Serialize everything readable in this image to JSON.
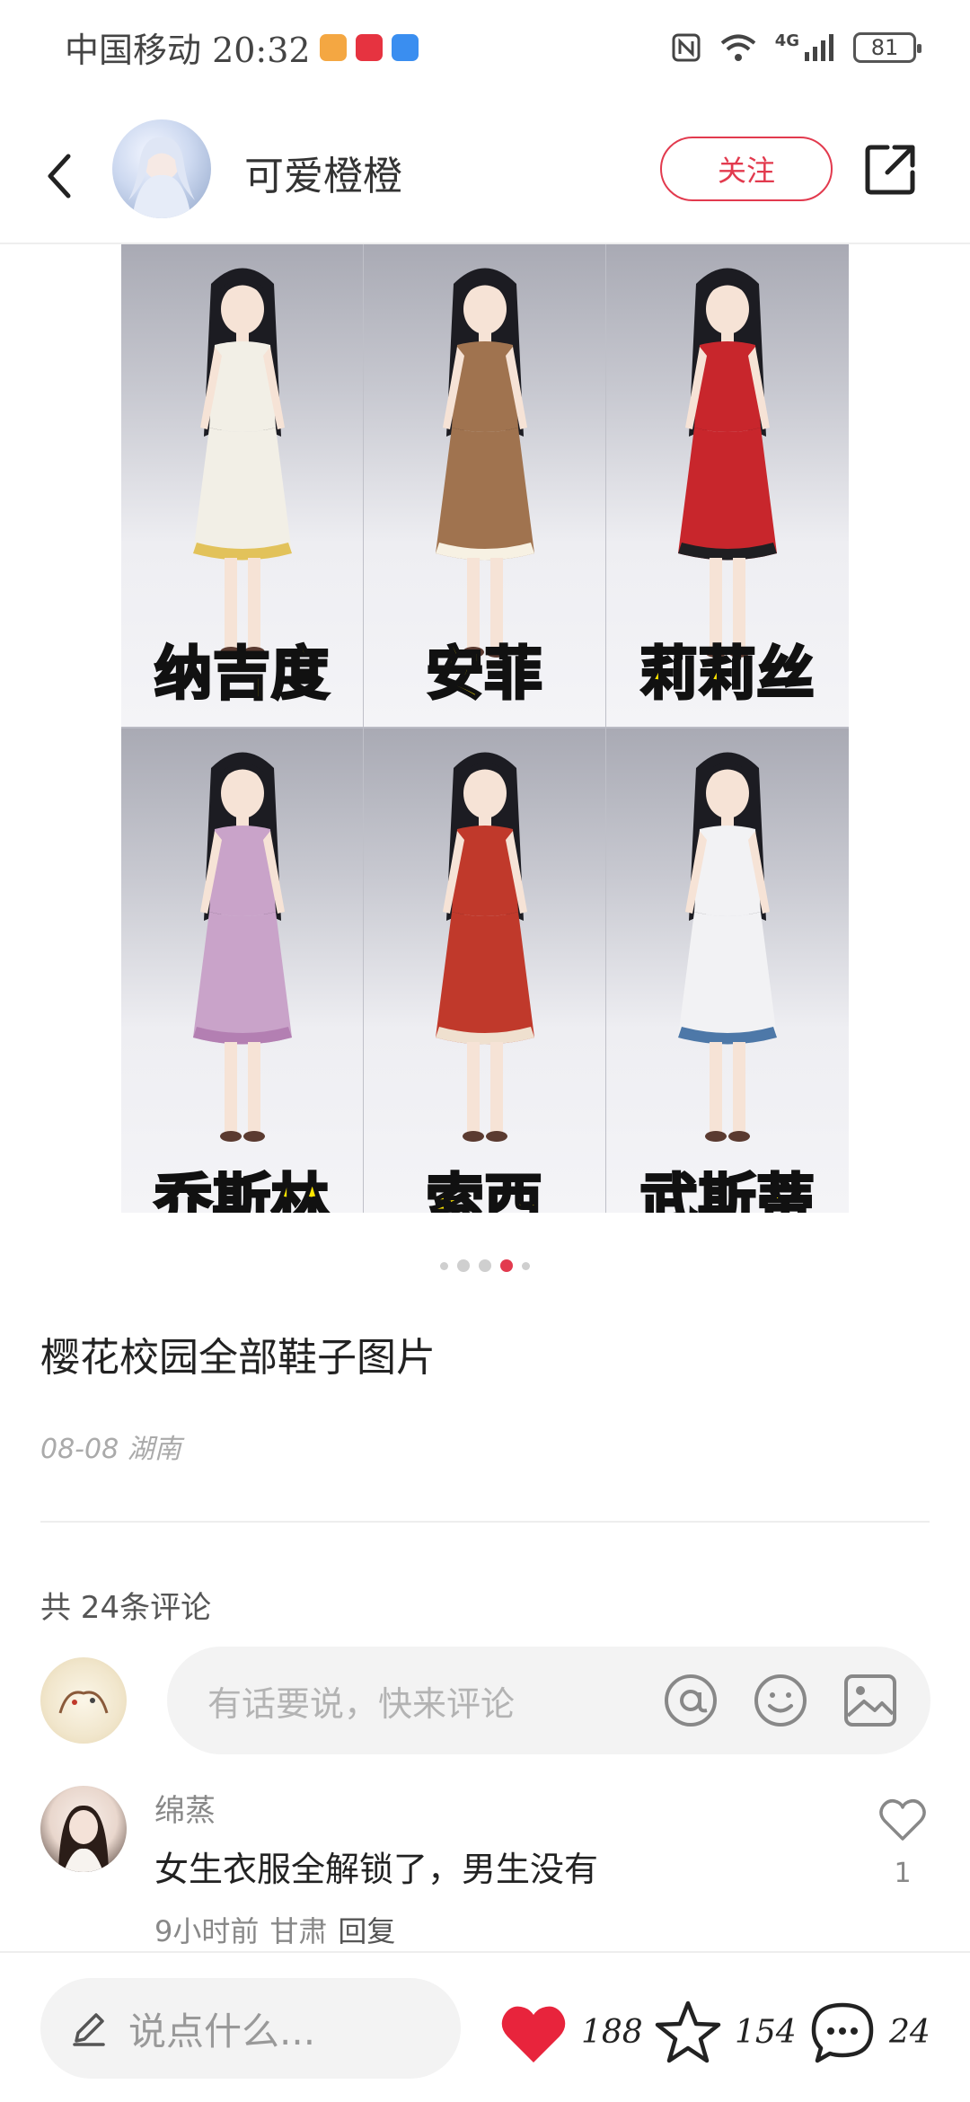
{
  "status_bar": {
    "carrier_time": "中国移动 20:32",
    "network": "4G",
    "battery": "81",
    "app_icon_colors": [
      "#f4a742",
      "#e63340",
      "#3a8ef0"
    ],
    "icons": [
      "nfc-icon",
      "wifi-icon",
      "signal-icon",
      "battery-icon"
    ]
  },
  "header": {
    "author_name": "可爱橙橙",
    "follow_label": "关注",
    "icons": [
      "back-icon",
      "share-icon"
    ]
  },
  "image": {
    "characters": [
      {
        "label": "纳吉度",
        "outfit_color": "#f2efe6",
        "accent": "#e2c25a"
      },
      {
        "label": "安菲",
        "outfit_color": "#a0734f",
        "accent": "#f7f1e3"
      },
      {
        "label": "莉莉丝",
        "outfit_color": "#c8262c",
        "accent": "#1f1f22"
      },
      {
        "label": "乔斯林",
        "outfit_color": "#c9a3c9",
        "accent": "#b37fb2"
      },
      {
        "label": "索西",
        "outfit_color": "#c0392b",
        "accent": "#efe0cf"
      },
      {
        "label": "武斯蒂",
        "outfit_color": "#f2f2f4",
        "accent": "#4d78a8"
      }
    ],
    "page_indicator": {
      "count": 5,
      "active_index": 3,
      "active_color": "#e23a4e"
    }
  },
  "post": {
    "title": "樱花校园全部鞋子图片",
    "date_location": "08-08 湖南"
  },
  "comments": {
    "count_label": "共 24条评论",
    "input_placeholder": "有话要说，快来评论",
    "input_icons": [
      "at-icon",
      "emoji-icon",
      "image-icon"
    ],
    "items": [
      {
        "user": "绵蒸",
        "text": "女生衣服全解锁了，男生没有",
        "time": "9小时前",
        "location": "甘肃",
        "reply_label": "回复",
        "likes": "1"
      }
    ]
  },
  "bottom_bar": {
    "say_placeholder": "说点什么...",
    "likes": "188",
    "favorites": "154",
    "comments": "24",
    "like_color": "#e8243c"
  }
}
